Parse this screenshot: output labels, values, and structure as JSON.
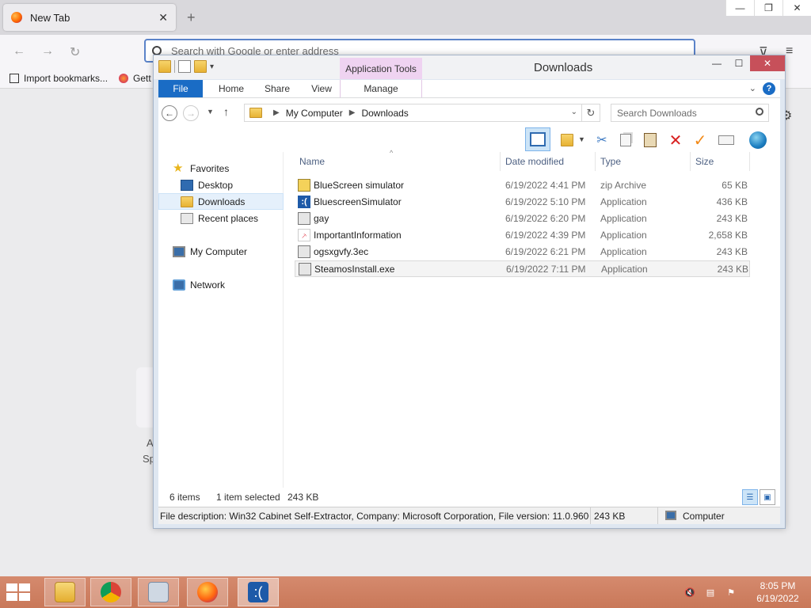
{
  "browser": {
    "tab_title": "New Tab",
    "tab_close": "✕",
    "new_tab": "+",
    "window_buttons": [
      "—",
      "❐",
      "✕"
    ],
    "url_placeholder": "Search with Google or enter address",
    "bookmarks": [
      "Import bookmarks...",
      "Gett"
    ],
    "bg_text": [
      "A",
      "Sp"
    ]
  },
  "explorer": {
    "title": "Downloads",
    "context_tab_group": "Application Tools",
    "window_buttons": [
      "—",
      "☐",
      "✕"
    ],
    "ribbon_tabs": [
      "File",
      "Home",
      "Share",
      "View",
      "Manage"
    ],
    "help": "?",
    "address": {
      "path": [
        "My Computer",
        "Downloads"
      ],
      "search_placeholder": "Search Downloads"
    },
    "nav_pane": {
      "favorites": "Favorites",
      "items": [
        "Desktop",
        "Downloads",
        "Recent places"
      ],
      "selected": "Downloads",
      "computer": "My Computer",
      "network": "Network"
    },
    "columns": [
      "Name",
      "Date modified",
      "Type",
      "Size"
    ],
    "files": [
      {
        "name": "BlueScreen simulator",
        "date": "6/19/2022 4:41 PM",
        "type": "zip Archive",
        "size": "65 KB",
        "icon": "zip-icon"
      },
      {
        "name": "BluescreenSimulator",
        "date": "6/19/2022 5:10 PM",
        "type": "Application",
        "size": "436 KB",
        "icon": "bluescreen-app-icon"
      },
      {
        "name": "gay",
        "date": "6/19/2022 6:20 PM",
        "type": "Application",
        "size": "243 KB",
        "icon": "installer-app-icon"
      },
      {
        "name": "ImportantInformation",
        "date": "6/19/2022 4:39 PM",
        "type": "Application",
        "size": "2,658 KB",
        "icon": "pdf-app-icon"
      },
      {
        "name": "ogsxgvfy.3ec",
        "date": "6/19/2022 6:21 PM",
        "type": "Application",
        "size": "243 KB",
        "icon": "installer-app-icon"
      },
      {
        "name": "SteamosInstall.exe",
        "date": "6/19/2022 7:11 PM",
        "type": "Application",
        "size": "243 KB",
        "icon": "installer-app-icon"
      }
    ],
    "selected_file": "SteamosInstall.exe",
    "status": {
      "item_count": "6 items",
      "selection": "1 item selected",
      "selection_size": "243 KB"
    },
    "details": {
      "description": "File description: Win32 Cabinet Self-Extractor, Company: Microsoft Corporation, File version: 11.0.9600.",
      "size": "243 KB",
      "location": "Computer"
    }
  },
  "taskbar": {
    "apps": [
      "file-explorer",
      "chrome",
      "calculator",
      "firefox",
      "bluescreen-simulator"
    ],
    "clock_time": "8:05 PM",
    "clock_date": "6/19/2022"
  },
  "colors": {
    "accent": "#1a6cc5",
    "taskbar": "#cd7f62",
    "context_tab": "#efd3f1"
  }
}
